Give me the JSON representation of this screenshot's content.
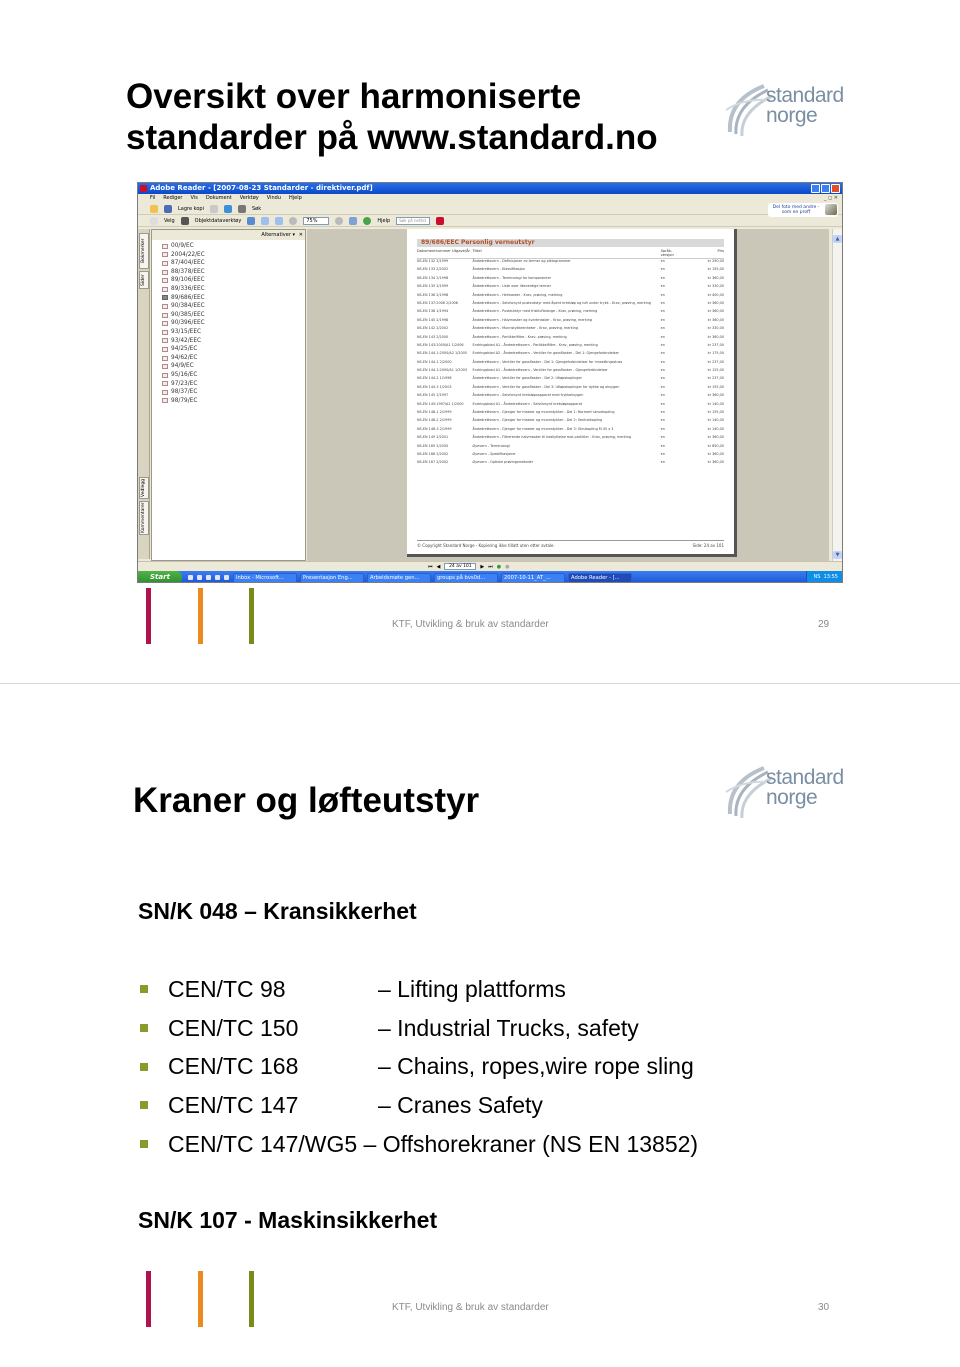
{
  "colors": {
    "magenta": "#b0124f",
    "orange": "#e98b1e",
    "green": "#7a8b1c",
    "logo": "#7a8fa3",
    "bullet": "#8b9a2a",
    "doc_title": "#b0502a"
  },
  "logo": {
    "line1": "standard",
    "line2": "norge"
  },
  "footer_text": "KTF, Utvikling & bruk av standarder",
  "slide1": {
    "title_line1": "Oversikt over harmoniserte",
    "title_line2": "standarder på www.standard.no",
    "page_number": "29",
    "screenshot": {
      "window_title": "Adobe Reader - [2007-08-23 Standarder - direktiver.pdf]",
      "menu": [
        "Fil",
        "Rediger",
        "Vis",
        "Dokument",
        "Verktøy",
        "Vindu",
        "Hjelp"
      ],
      "toolbar1": {
        "save_copy": "Lagre kopi",
        "search": "Søk"
      },
      "toolbar2": {
        "select": "Velg",
        "object_tool": "Objektdataverktøy",
        "zoom_value": "75%",
        "help": "Hjelp",
        "search_placeholder": "Søk på nettet"
      },
      "promo": "Del foto med andre - som en proff",
      "sidetabs": [
        "Bokmerker",
        "Sider",
        "Vedlegg",
        "Kommentarer"
      ],
      "nav_options": "Alternativer",
      "bookmarks": [
        "00/9/EC",
        "2004/22/EC",
        "87/404/EEC",
        "88/378/EEC",
        "89/106/EEC",
        "89/336/EEC",
        "89/686/EEC",
        "90/384/EEC",
        "90/385/EEC",
        "90/396/EEC",
        "93/15/EEC",
        "93/42/EEC",
        "94/25/EC",
        "94/62/EC",
        "94/9/EC",
        "95/16/EC",
        "97/23/EC",
        "98/37/EC",
        "98/79/EC"
      ],
      "active_bookmark": "89/686/EEC",
      "document": {
        "heading": "89/686/EEC  Personlig verneutstyr",
        "columns": [
          "Dokumentnummer Utgave/År",
          "Tittel",
          "Språk-versjon",
          "Pris"
        ],
        "rows": [
          [
            "NS-EN 132 2/1999",
            "Åndedrettsvern - Definisjoner av termer og piktogrammer",
            "en",
            "kr 290,00"
          ],
          [
            "NS-EN 133 2/2002",
            "Åndedrettsvern - Klassifikasjon",
            "en",
            "kr 155,00"
          ],
          [
            "NS-EN 134 2/1998",
            "Åndedrettsvern - Terminologi for komponenter",
            "en",
            "kr 360,00"
          ],
          [
            "NS-EN 135 2/1999",
            "Åndedrettsvern - Liste over likeverdige termer",
            "en",
            "kr 330,00"
          ],
          [
            "NS-EN 136 2/1998",
            "Åndedrettsvern - Helmasker - Krav, prøving, merking",
            "en",
            "kr 400,00"
          ],
          [
            "NS-EN 137:2006 2/2006",
            "Åndedrettsvern - Selvforsynt pusteutstyr med åpent kretsløp og luft under trykk - Krav, prøving, merking",
            "en",
            "kr 360,00"
          ],
          [
            "NS-EN 138 1/1994",
            "Åndedrettsvern - Pusteutstyr med friskluftslange - Krav, prøving, merking",
            "en",
            "kr 360,00"
          ],
          [
            "NS-EN 140 2/1998",
            "Åndedrettsvern - Halvmasker og kvartmasker - Krav, prøving, merking",
            "en",
            "kr 360,00"
          ],
          [
            "NS-EN 142 2/2002",
            "Åndedrettsvern - Munnstykkeenheter - Krav, prøving, merking",
            "en",
            "kr 330,00"
          ],
          [
            "NS-EN 143 2/2000",
            "Åndedrettsvern - Partikkelfiltre - Krav, prøving, merking",
            "en",
            "kr 360,00"
          ],
          [
            "NS-EN 143:2000/A1 1/2006",
            "Endringsblad A1 - Åndedrettsvern - Partikkelfiltre - Krav, prøving, merking",
            "en",
            "kr 237,00"
          ],
          [
            "NS-EN 144-1:2000/A2 1/2005",
            "Endringsblad A2 - Åndedrettsvern - Ventiler for gassflasker - Del 1: Gjengeforbindelser",
            "en",
            "kr 175,00"
          ],
          [
            "NS-EN 144-1 2/2000",
            "Åndedrettsvern - Ventiler for gassflasker - Del 1: Gjengeforbindelser for innsettingsstuss",
            "en",
            "kr 237,00"
          ],
          [
            "NS-EN 144-1:2000/A1 1/2003",
            "Endringsblad A1 - Åndedrettsvern - Ventiler for gassflasker - Gjengeforbindelser",
            "en",
            "kr 125,00"
          ],
          [
            "NS-EN 144-2 1/1998",
            "Åndedrettsvern - Ventiler for gassflasker - Del 2: Utløpskoplinger",
            "en",
            "kr 237,00"
          ],
          [
            "NS-EN 144-3 1/2003",
            "Åndedrettsvern - Ventiler for gassflasker - Del 3: Utløpskoplinger for dykke og oksygen",
            "en",
            "kr 155,00"
          ],
          [
            "NS-EN 145 2/1997",
            "Åndedrettsvern - Selvforsynt kretsløpsapparat med trykkoksygen",
            "en",
            "kr 360,00"
          ],
          [
            "NS-EN 145:1997/A1 1/2000",
            "Endringsblad A1 - Åndedrettsvern - Selvforsynt kretsløpsapparat",
            "en",
            "kr 140,00"
          ],
          [
            "NS-EN 148-1 2/1999",
            "Åndedrettsvern - Gjenger for masker og munnstykker - Del 1: Normert skruekopling",
            "en",
            "kr 155,00"
          ],
          [
            "NS-EN 148-2 2/1999",
            "Åndedrettsvern - Gjenger for masker og munnstykker - Del 2: Sentralkopling",
            "en",
            "kr 140,00"
          ],
          [
            "NS-EN 148-3 2/1999",
            "Åndedrettsvern - Gjenger for masker og munnstykker - Del 3: Skrukopling M 45 x 3",
            "en",
            "kr 140,00"
          ],
          [
            "NS-EN 149 2/2001",
            "Åndedrettsvern - Filtrerende halvmasker til beskyttelse mot partikler - Krav, prøving, merking",
            "en",
            "kr 360,00"
          ],
          [
            "NS-EN 165 2/2005",
            "Øyevern - Terminologi",
            "en",
            "kr 650,00"
          ],
          [
            "NS-EN 166 2/2002",
            "Øyevern - Spesifikasjoner",
            "en",
            "kr 360,00"
          ],
          [
            "NS-EN 167 2/2002",
            "Øyevern - Optiske prøvingsmetoder",
            "en",
            "kr 360,00"
          ]
        ],
        "footer_left": "© Copyright Standard Norge - Kopiering ikke tillatt uten etter avtale.",
        "footer_right": "Side: 24 av 101"
      },
      "page_indicator": "24 av 101",
      "taskbar": {
        "start": "Start",
        "tasks": [
          "Inbox - Microsoft...",
          "Presentasjon Eng...",
          "Arbeidsmøte gen...",
          "groups på bvs0d...",
          "2007-10-11_AT_...",
          "Adobe Reader - [..."
        ],
        "active_task": "Adobe Reader - [...",
        "tray_lang": "NS",
        "clock": "13:55"
      }
    }
  },
  "slide2": {
    "title": "Kraner og løfteutstyr",
    "page_number": "30",
    "subhead1": "SN/K 048 – Kransikkerhet",
    "bullets": [
      {
        "code": "CEN/TC 98",
        "desc": "– Lifting plattforms"
      },
      {
        "code": "CEN/TC 150",
        "desc": "– Industrial Trucks, safety"
      },
      {
        "code": "CEN/TC 168",
        "desc": "– Chains, ropes,wire rope sling"
      },
      {
        "code": "CEN/TC 147",
        "desc": "– Cranes Safety"
      },
      {
        "code": "CEN/TC 147/WG5",
        "desc": "– Offshorekraner (NS EN 13852)"
      }
    ],
    "subhead2": "SN/K 107 - Maskinsikkerhet"
  }
}
